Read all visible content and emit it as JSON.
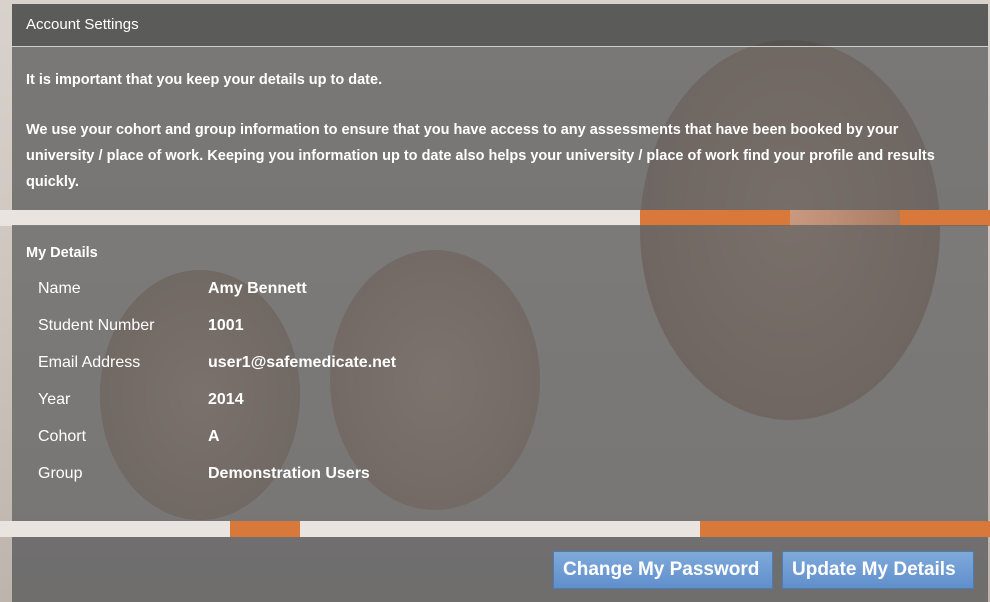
{
  "header": {
    "title": "Account Settings"
  },
  "intro": {
    "paragraph1": "It is important that you keep your details up to date.",
    "paragraph2": "We use your cohort and group information to ensure that you have access to any assessments that have been booked by your university / place of work. Keeping you information up to date also helps your university / place of work find your profile and results quickly."
  },
  "details": {
    "heading": "My Details",
    "rows": [
      {
        "label": "Name",
        "value": "Amy Bennett"
      },
      {
        "label": "Student Number",
        "value": "1001"
      },
      {
        "label": "Email Address",
        "value": "user1@safemedicate.net"
      },
      {
        "label": "Year",
        "value": "2014"
      },
      {
        "label": "Cohort",
        "value": "A"
      },
      {
        "label": "Group",
        "value": "Demonstration Users"
      }
    ]
  },
  "actions": {
    "change_password": "Change My Password",
    "update_details": "Update My Details"
  },
  "colors": {
    "button": "#6d9cd3",
    "panel": "#646464",
    "text": "#ffffff"
  }
}
